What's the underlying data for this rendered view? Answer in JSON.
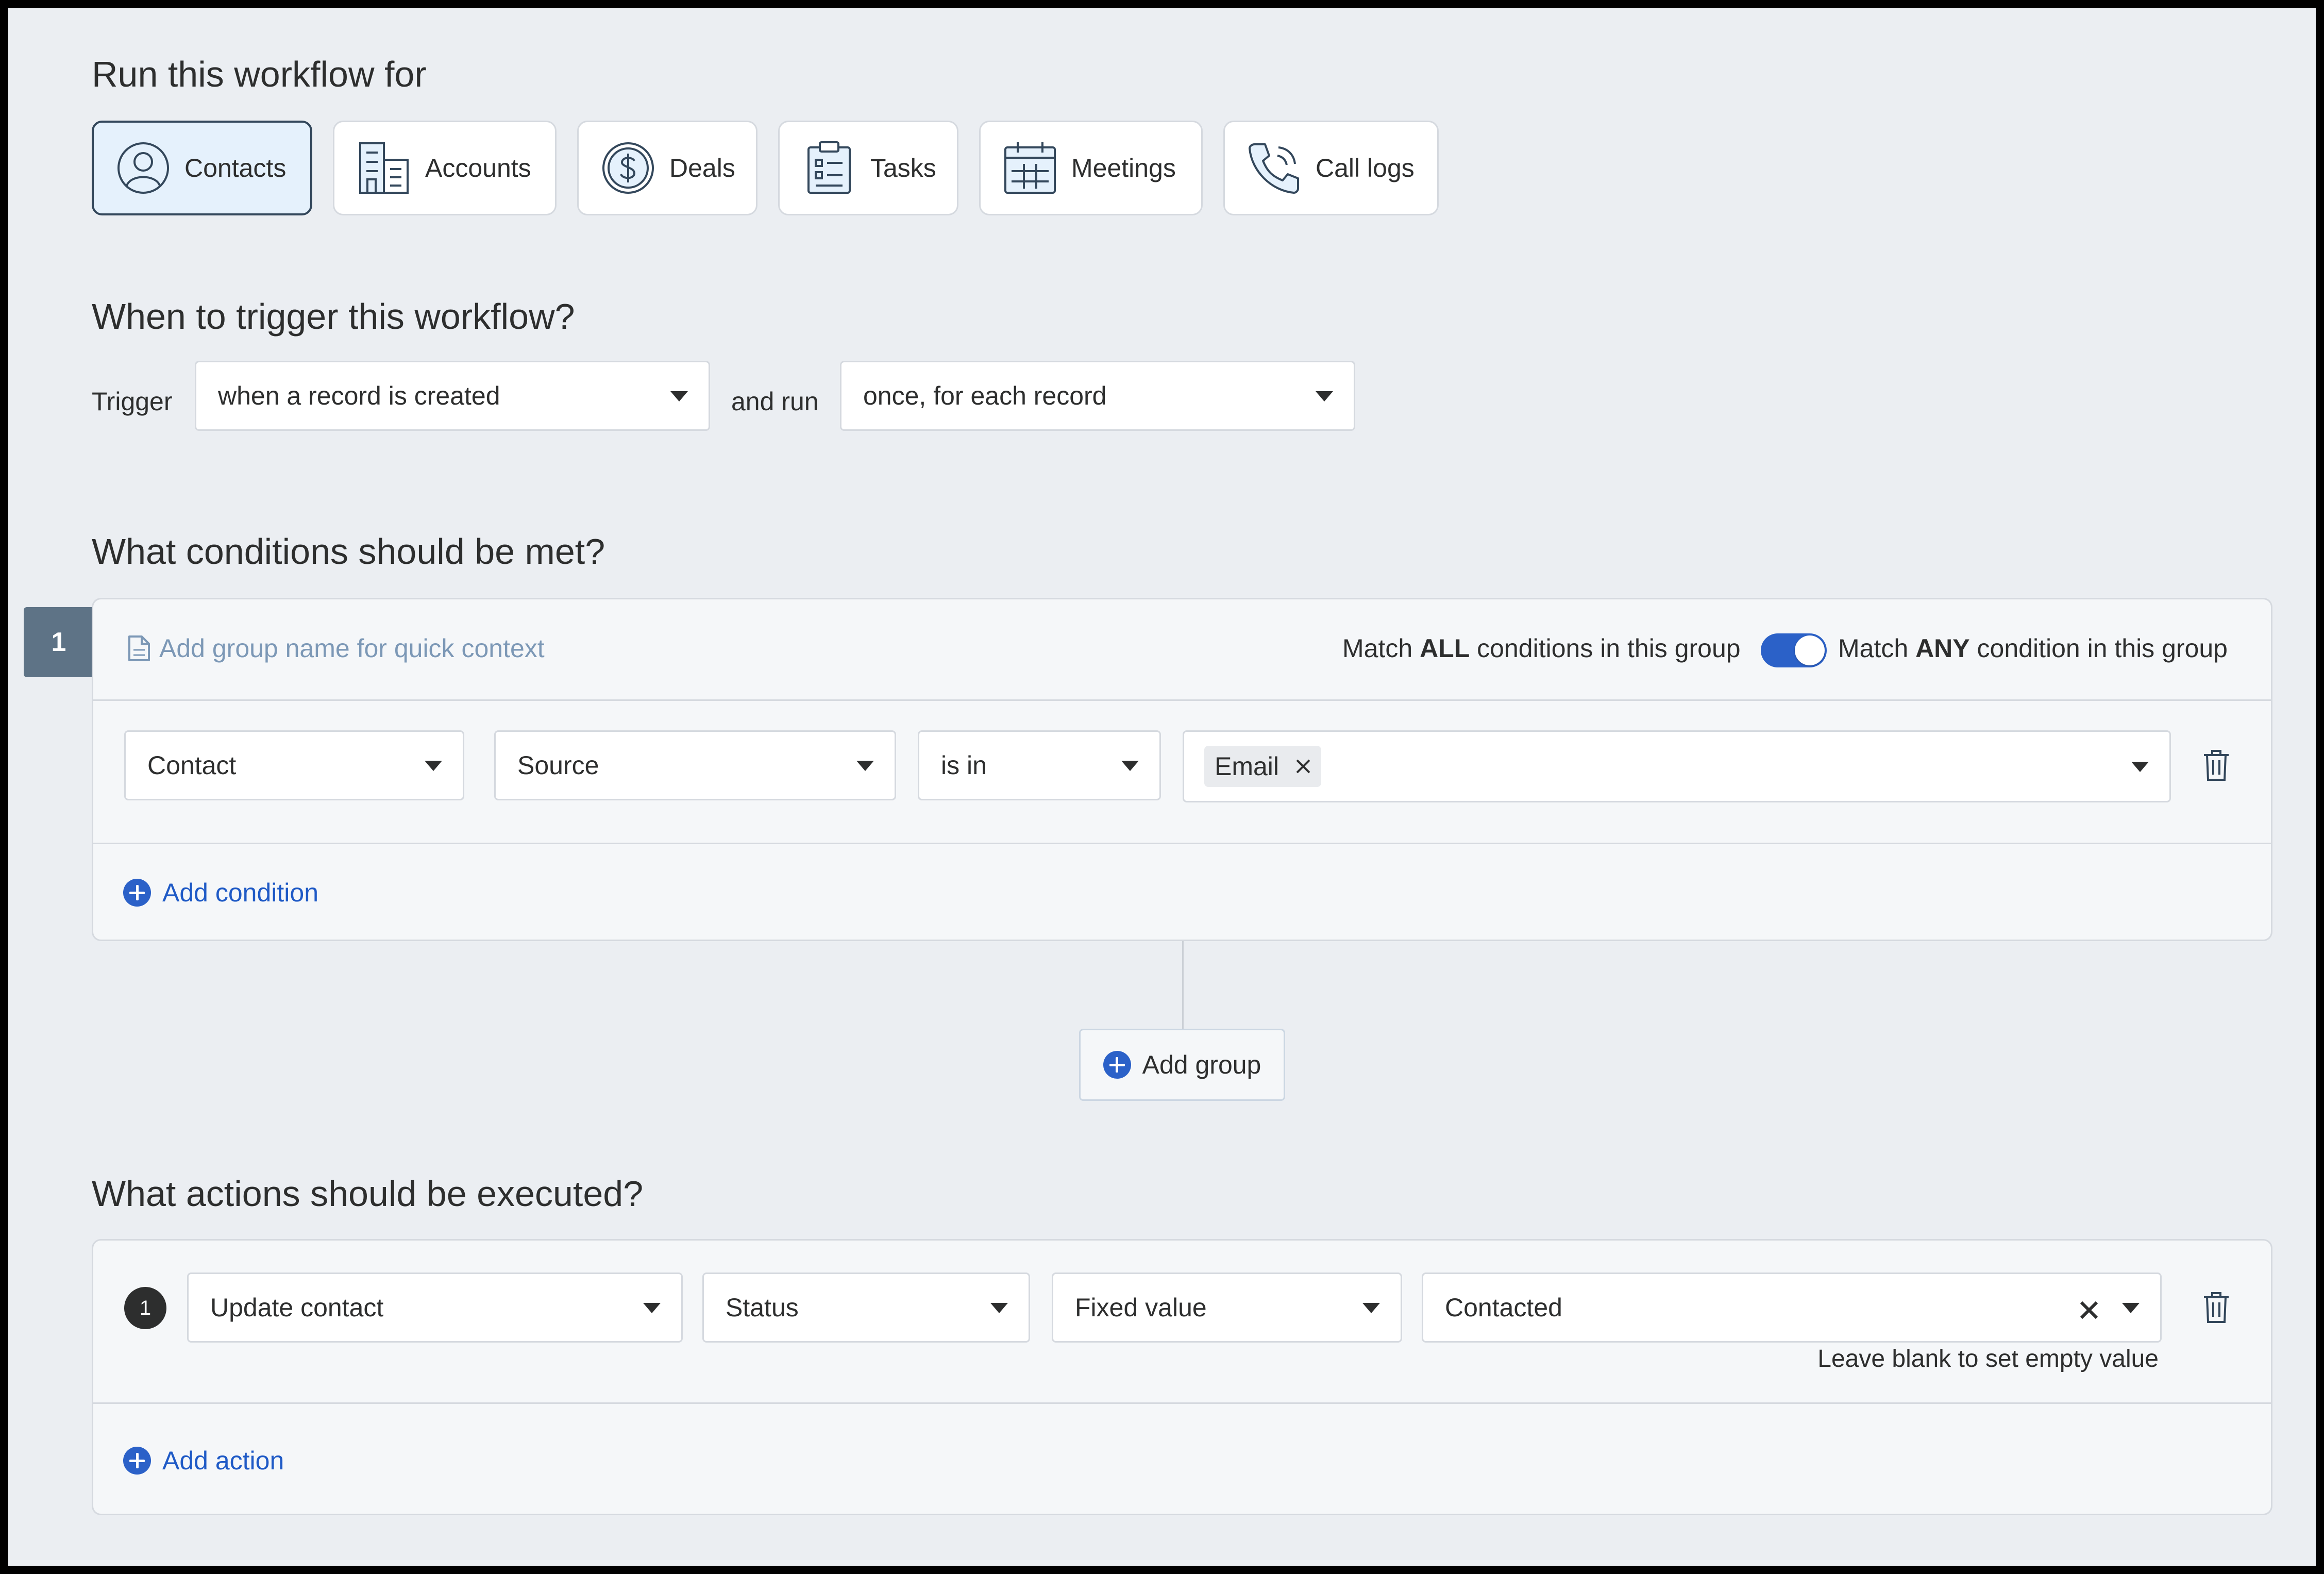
{
  "run_section": {
    "title": "Run this workflow for",
    "entities": [
      {
        "label": "Contacts",
        "icon": "contact-icon",
        "selected": true
      },
      {
        "label": "Accounts",
        "icon": "building-icon",
        "selected": false
      },
      {
        "label": "Deals",
        "icon": "dollar-icon",
        "selected": false
      },
      {
        "label": "Tasks",
        "icon": "clipboard-icon",
        "selected": false
      },
      {
        "label": "Meetings",
        "icon": "calendar-icon",
        "selected": false
      },
      {
        "label": "Call logs",
        "icon": "phone-icon",
        "selected": false
      }
    ]
  },
  "trigger_section": {
    "title": "When to trigger this workflow?",
    "trigger_label": "Trigger",
    "trigger_value": "when a record is created",
    "run_label": "and run",
    "run_value": "once, for each record"
  },
  "conditions_section": {
    "title": "What conditions should be met?",
    "group_number": "1",
    "group_name_placeholder": "Add group name for quick context",
    "match_all_prefix": "Match ",
    "match_all_bold": "ALL",
    "match_all_suffix": " conditions in this group",
    "match_any_prefix": "Match ",
    "match_any_bold": "ANY",
    "match_any_suffix": " condition in this group",
    "toggle_state": "any",
    "condition": {
      "entity": "Contact",
      "field": "Source",
      "operator": "is in",
      "values": [
        "Email"
      ]
    },
    "add_condition_label": "Add condition",
    "add_group_label": "Add group"
  },
  "actions_section": {
    "title": "What actions should be executed?",
    "action": {
      "number": "1",
      "type": "Update contact",
      "field": "Status",
      "value_mode": "Fixed value",
      "value": "Contacted",
      "hint": "Leave blank to set empty value"
    },
    "add_action_label": "Add action"
  },
  "colors": {
    "accent": "#2b61c8",
    "link": "#1f5ac6",
    "selected_bg": "#e5f1fc",
    "badge_bg": "#5e7386"
  }
}
